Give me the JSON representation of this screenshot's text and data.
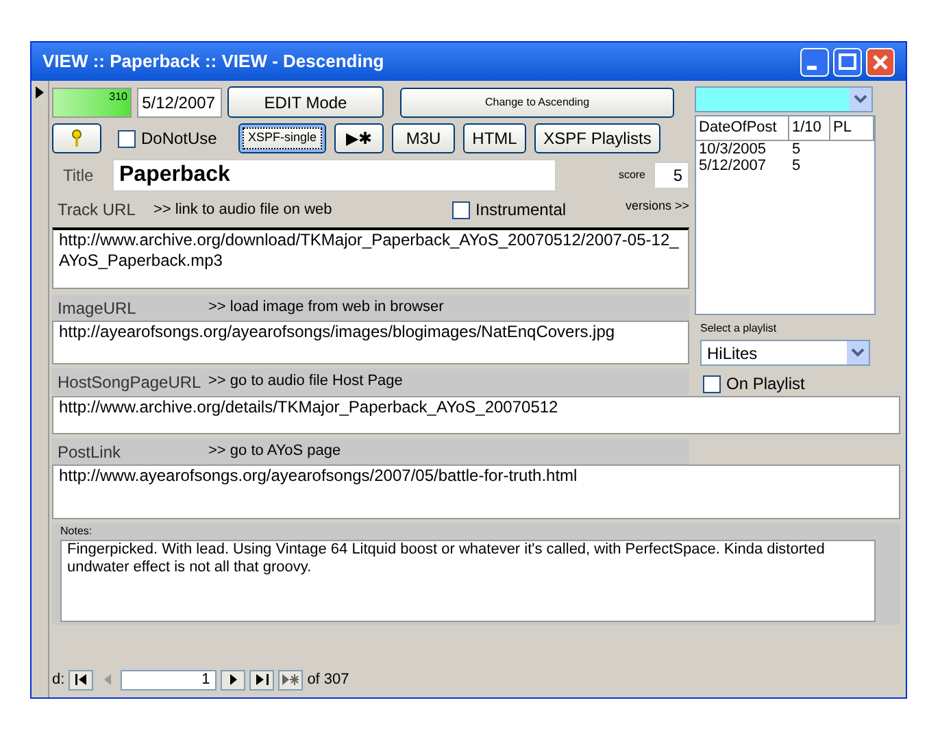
{
  "window": {
    "title": "VIEW :: Paperback :: VIEW - Descending"
  },
  "record_counter": {
    "value": "310"
  },
  "date_field": {
    "value": "5/12/2007"
  },
  "edit_button": {
    "label": "EDIT Mode"
  },
  "sort_button": {
    "label": "Change to Ascending"
  },
  "do_not_use": {
    "label": "DoNotUse",
    "checked": false
  },
  "toolbar_buttons": [
    {
      "label": "XSPF-single",
      "selected": true
    },
    {
      "label": "▶✱",
      "selected": false
    },
    {
      "label": "M3U",
      "selected": false
    },
    {
      "label": "HTML",
      "selected": false
    },
    {
      "label": "XSPF Playlists",
      "selected": false
    }
  ],
  "title_field": {
    "label": "Title",
    "value": "Paperback"
  },
  "score_field": {
    "label": "score",
    "value": "5"
  },
  "versions_link": "versions >>",
  "instrumental": {
    "label": "Instrumental",
    "checked": false
  },
  "versions_table": {
    "columns": [
      "DateOfPost",
      "1/10",
      "PL"
    ],
    "rows": [
      {
        "date": "10/3/2005",
        "score": "5"
      },
      {
        "date": "5/12/2007",
        "score": "5"
      }
    ]
  },
  "playlist": {
    "label": "Select a playlist",
    "value": "HiLites"
  },
  "on_playlist": {
    "label": "On Playlist",
    "checked": false
  },
  "url_sections": [
    {
      "label": "Track URL",
      "link": ">> link to audio file on web",
      "value": "http://www.archive.org/download/TKMajor_Paperback_AYoS_20070512/2007-05-12_AYoS_Paperback.mp3"
    },
    {
      "label": "ImageURL",
      "link": ">> load image from web in browser",
      "value": "http://ayearofsongs.org/ayearofsongs/images/blogimages/NatEnqCovers.jpg"
    },
    {
      "label": "HostSongPageURL",
      "link": ">> go to audio file Host Page",
      "value": "http://www.archive.org/details/TKMajor_Paperback_AYoS_20070512"
    },
    {
      "label": "PostLink",
      "link": ">> go to AYoS page",
      "value": "http://www.ayearofsongs.org/ayearofsongs/2007/05/battle-for-truth.html"
    }
  ],
  "notes": {
    "label": "Notes:",
    "value": "Fingerpicked. With lead. Using Vintage 64 Litquid boost or whatever it's called, with PerfectSpace. Kinda distorted undwater effect is not all that groovy."
  },
  "navigator": {
    "label": "d:",
    "current": "1",
    "total": "of 307"
  }
}
